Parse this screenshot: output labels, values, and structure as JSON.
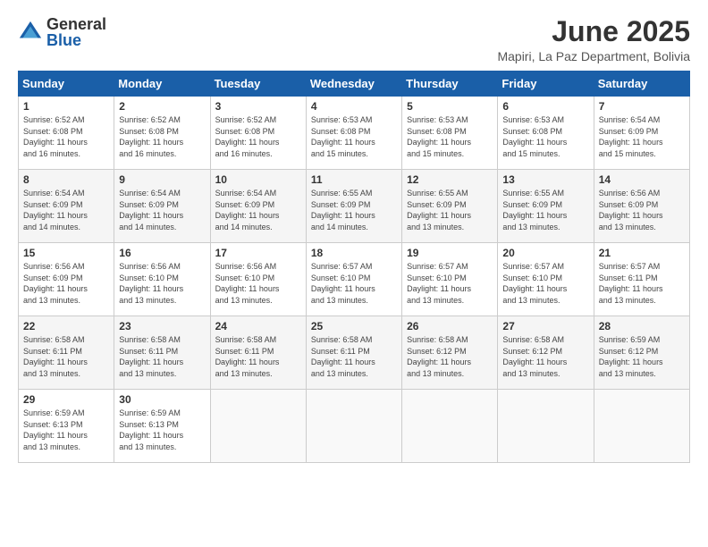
{
  "header": {
    "logo_general": "General",
    "logo_blue": "Blue",
    "title": "June 2025",
    "subtitle": "Mapiri, La Paz Department, Bolivia"
  },
  "calendar": {
    "days_of_week": [
      "Sunday",
      "Monday",
      "Tuesday",
      "Wednesday",
      "Thursday",
      "Friday",
      "Saturday"
    ],
    "weeks": [
      [
        {
          "day": "",
          "info": ""
        },
        {
          "day": "2",
          "info": "Sunrise: 6:52 AM\nSunset: 6:08 PM\nDaylight: 11 hours\nand 16 minutes."
        },
        {
          "day": "3",
          "info": "Sunrise: 6:52 AM\nSunset: 6:08 PM\nDaylight: 11 hours\nand 16 minutes."
        },
        {
          "day": "4",
          "info": "Sunrise: 6:53 AM\nSunset: 6:08 PM\nDaylight: 11 hours\nand 15 minutes."
        },
        {
          "day": "5",
          "info": "Sunrise: 6:53 AM\nSunset: 6:08 PM\nDaylight: 11 hours\nand 15 minutes."
        },
        {
          "day": "6",
          "info": "Sunrise: 6:53 AM\nSunset: 6:08 PM\nDaylight: 11 hours\nand 15 minutes."
        },
        {
          "day": "7",
          "info": "Sunrise: 6:54 AM\nSunset: 6:09 PM\nDaylight: 11 hours\nand 15 minutes."
        }
      ],
      [
        {
          "day": "1",
          "info": "Sunrise: 6:52 AM\nSunset: 6:08 PM\nDaylight: 11 hours\nand 16 minutes."
        },
        {
          "day": "8",
          "info": ""
        },
        {
          "day": "9",
          "info": ""
        },
        {
          "day": "10",
          "info": ""
        },
        {
          "day": "11",
          "info": ""
        },
        {
          "day": "12",
          "info": ""
        },
        {
          "day": "13",
          "info": ""
        }
      ],
      [
        {
          "day": "8",
          "info": "Sunrise: 6:54 AM\nSunset: 6:09 PM\nDaylight: 11 hours\nand 14 minutes."
        },
        {
          "day": "9",
          "info": "Sunrise: 6:54 AM\nSunset: 6:09 PM\nDaylight: 11 hours\nand 14 minutes."
        },
        {
          "day": "10",
          "info": "Sunrise: 6:54 AM\nSunset: 6:09 PM\nDaylight: 11 hours\nand 14 minutes."
        },
        {
          "day": "11",
          "info": "Sunrise: 6:55 AM\nSunset: 6:09 PM\nDaylight: 11 hours\nand 14 minutes."
        },
        {
          "day": "12",
          "info": "Sunrise: 6:55 AM\nSunset: 6:09 PM\nDaylight: 11 hours\nand 13 minutes."
        },
        {
          "day": "13",
          "info": "Sunrise: 6:55 AM\nSunset: 6:09 PM\nDaylight: 11 hours\nand 13 minutes."
        },
        {
          "day": "14",
          "info": "Sunrise: 6:56 AM\nSunset: 6:09 PM\nDaylight: 11 hours\nand 13 minutes."
        }
      ],
      [
        {
          "day": "15",
          "info": "Sunrise: 6:56 AM\nSunset: 6:09 PM\nDaylight: 11 hours\nand 13 minutes."
        },
        {
          "day": "16",
          "info": "Sunrise: 6:56 AM\nSunset: 6:10 PM\nDaylight: 11 hours\nand 13 minutes."
        },
        {
          "day": "17",
          "info": "Sunrise: 6:56 AM\nSunset: 6:10 PM\nDaylight: 11 hours\nand 13 minutes."
        },
        {
          "day": "18",
          "info": "Sunrise: 6:57 AM\nSunset: 6:10 PM\nDaylight: 11 hours\nand 13 minutes."
        },
        {
          "day": "19",
          "info": "Sunrise: 6:57 AM\nSunset: 6:10 PM\nDaylight: 11 hours\nand 13 minutes."
        },
        {
          "day": "20",
          "info": "Sunrise: 6:57 AM\nSunset: 6:10 PM\nDaylight: 11 hours\nand 13 minutes."
        },
        {
          "day": "21",
          "info": "Sunrise: 6:57 AM\nSunset: 6:11 PM\nDaylight: 11 hours\nand 13 minutes."
        }
      ],
      [
        {
          "day": "22",
          "info": "Sunrise: 6:58 AM\nSunset: 6:11 PM\nDaylight: 11 hours\nand 13 minutes."
        },
        {
          "day": "23",
          "info": "Sunrise: 6:58 AM\nSunset: 6:11 PM\nDaylight: 11 hours\nand 13 minutes."
        },
        {
          "day": "24",
          "info": "Sunrise: 6:58 AM\nSunset: 6:11 PM\nDaylight: 11 hours\nand 13 minutes."
        },
        {
          "day": "25",
          "info": "Sunrise: 6:58 AM\nSunset: 6:11 PM\nDaylight: 11 hours\nand 13 minutes."
        },
        {
          "day": "26",
          "info": "Sunrise: 6:58 AM\nSunset: 6:12 PM\nDaylight: 11 hours\nand 13 minutes."
        },
        {
          "day": "27",
          "info": "Sunrise: 6:58 AM\nSunset: 6:12 PM\nDaylight: 11 hours\nand 13 minutes."
        },
        {
          "day": "28",
          "info": "Sunrise: 6:59 AM\nSunset: 6:12 PM\nDaylight: 11 hours\nand 13 minutes."
        }
      ],
      [
        {
          "day": "29",
          "info": "Sunrise: 6:59 AM\nSunset: 6:13 PM\nDaylight: 11 hours\nand 13 minutes."
        },
        {
          "day": "30",
          "info": "Sunrise: 6:59 AM\nSunset: 6:13 PM\nDaylight: 11 hours\nand 13 minutes."
        },
        {
          "day": "",
          "info": ""
        },
        {
          "day": "",
          "info": ""
        },
        {
          "day": "",
          "info": ""
        },
        {
          "day": "",
          "info": ""
        },
        {
          "day": "",
          "info": ""
        }
      ]
    ]
  }
}
